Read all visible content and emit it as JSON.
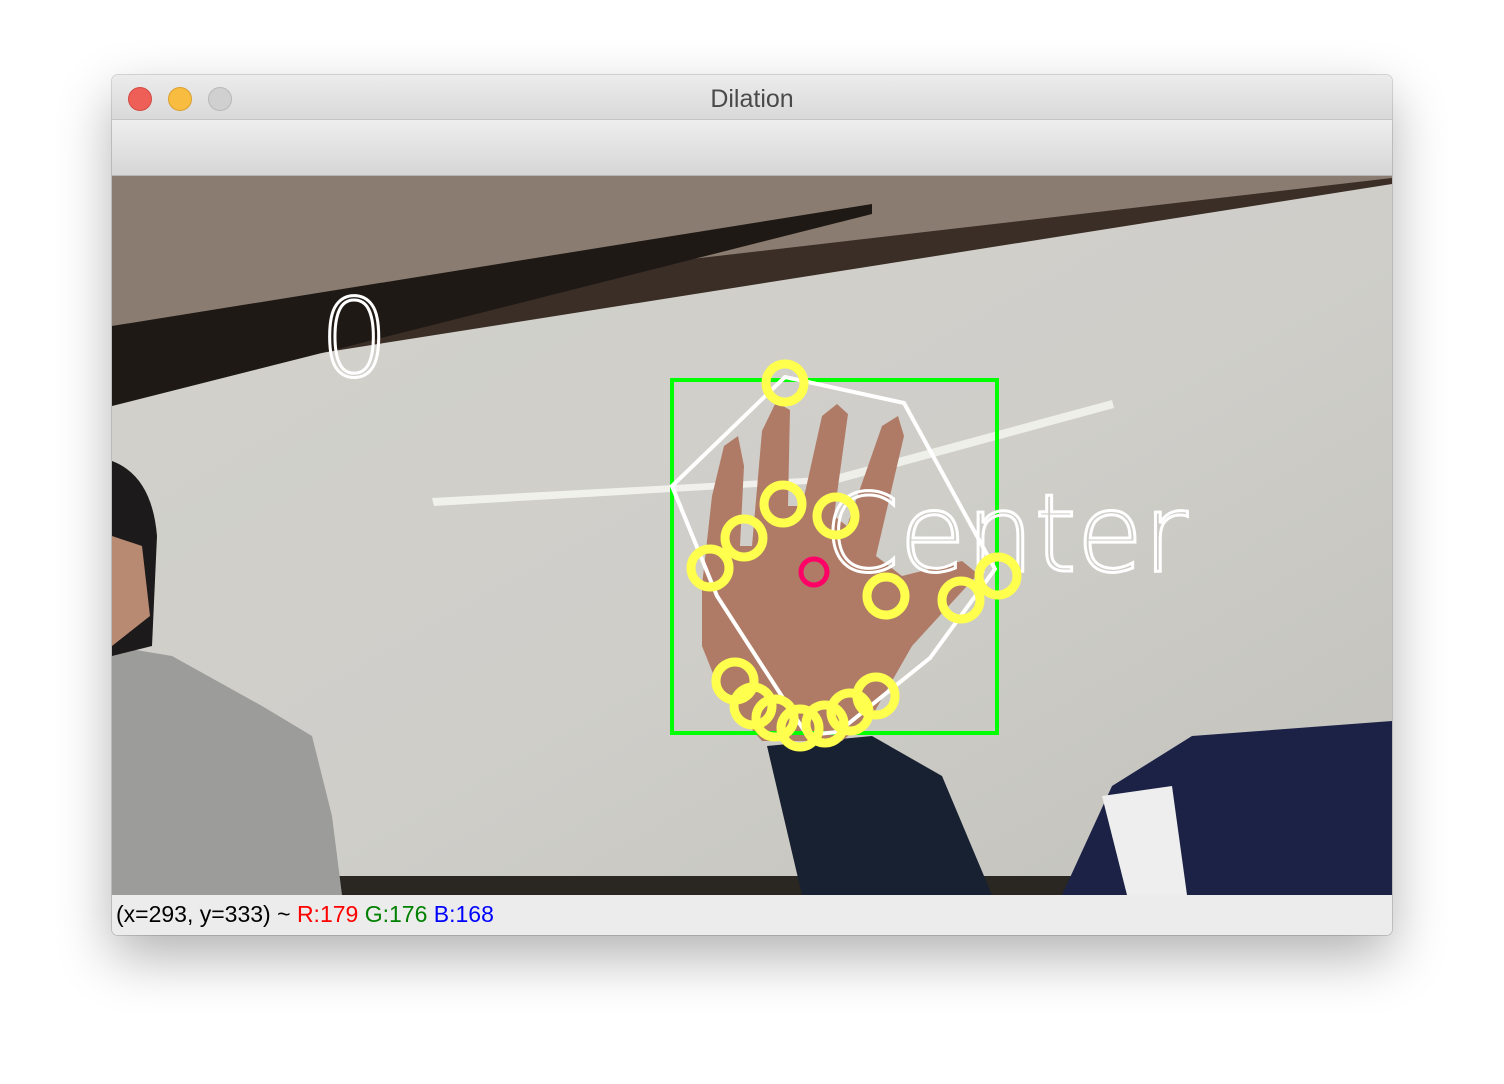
{
  "window": {
    "title": "Dilation"
  },
  "overlay": {
    "count_label": "0",
    "center_label": "Center"
  },
  "status": {
    "coords": "(x=293, y=333) ~ ",
    "r": "R:179",
    "g": "G:176",
    "b": "B:168"
  },
  "colors": {
    "bbox": "#00ff00",
    "hull": "#ffffff",
    "defect_points": "#ffff4d",
    "center_point": "#ff0066"
  }
}
